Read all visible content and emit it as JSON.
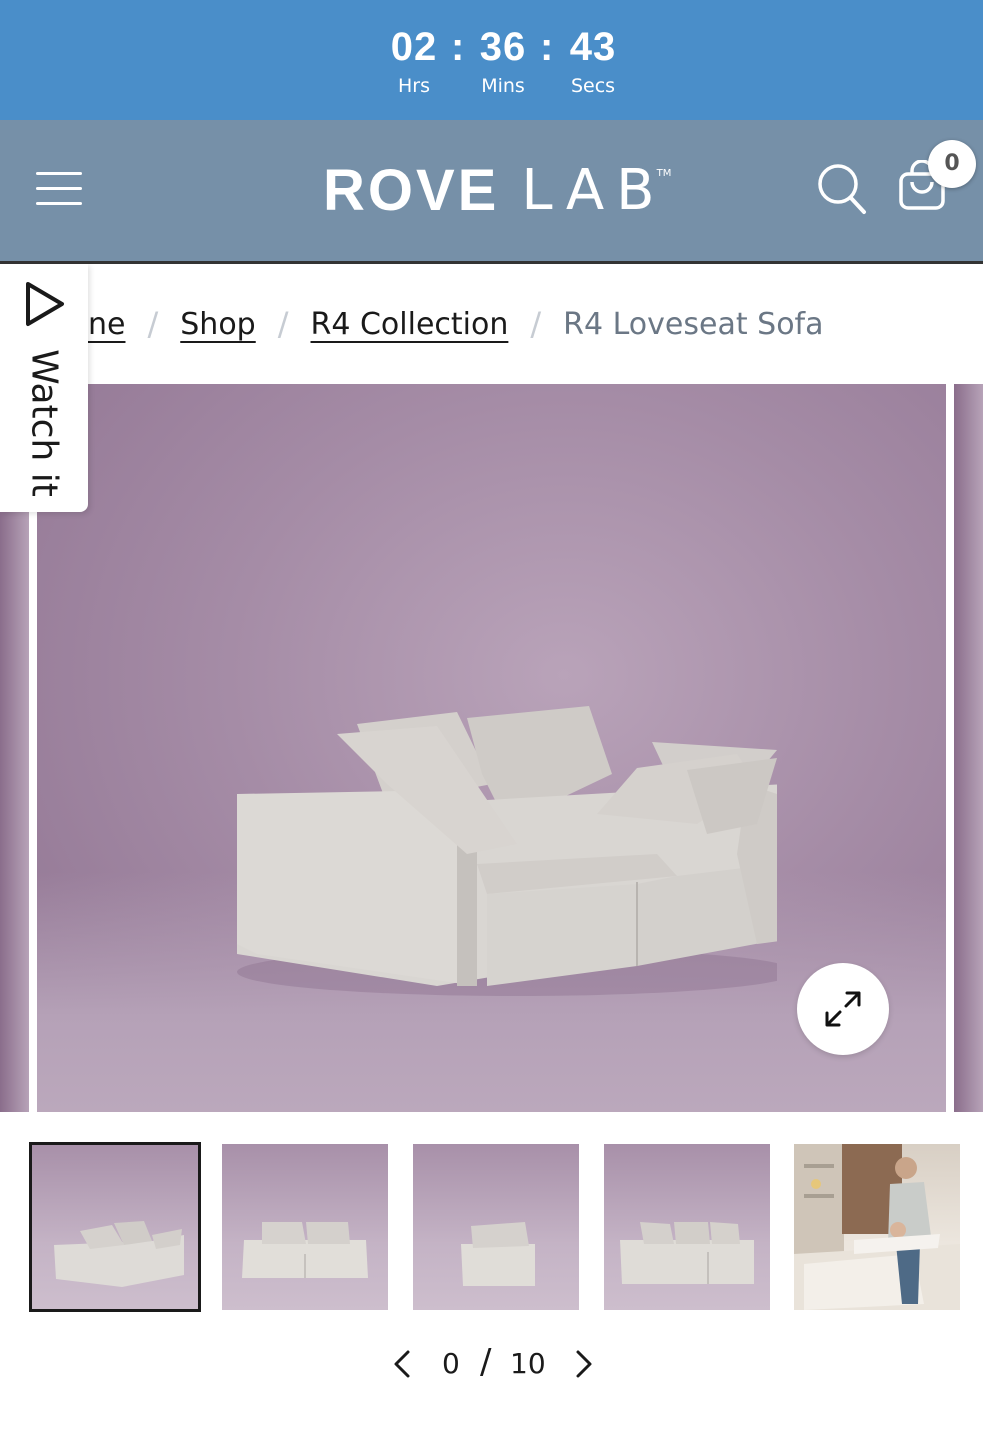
{
  "countdown": {
    "hours": "02",
    "hours_label": "Hrs",
    "minutes": "36",
    "minutes_label": "Mins",
    "seconds": "43",
    "seconds_label": "Secs",
    "separator": ":",
    "background": "#4a8ec9"
  },
  "header": {
    "background": "#7690a8",
    "logo_primary": "ROVE",
    "logo_secondary": "LAB",
    "logo_tm": "TM",
    "cart_count": "0",
    "icons": [
      "menu-icon",
      "search-icon",
      "cart-icon"
    ]
  },
  "watch_tab": {
    "label": "Watch it",
    "icon": "play-icon"
  },
  "breadcrumb": {
    "items": [
      {
        "label": "ne"
      },
      {
        "label": "Shop"
      },
      {
        "label": "R4 Collection"
      }
    ],
    "separator": "/",
    "current": "R4 Loveseat Sofa"
  },
  "gallery": {
    "expand_icon": "expand-icon",
    "thumbnails": 5
  },
  "pager": {
    "current": "0",
    "separator": "/",
    "total": "10",
    "icons": [
      "chevron-left-icon",
      "chevron-right-icon"
    ]
  }
}
